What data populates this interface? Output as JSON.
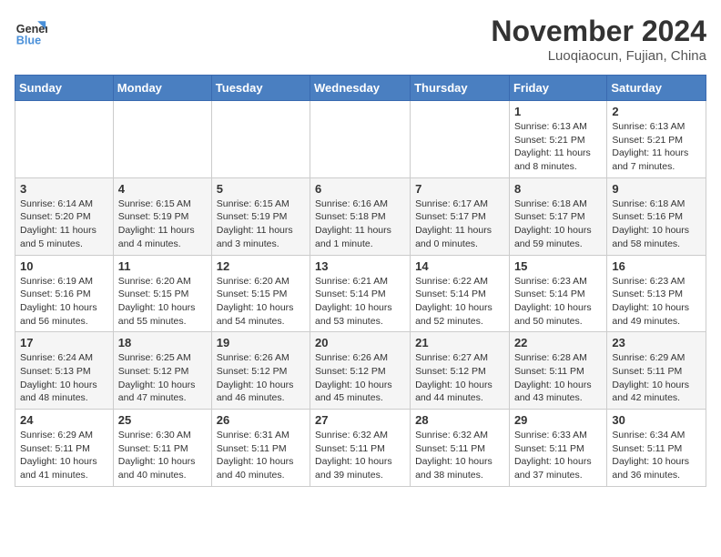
{
  "header": {
    "logo_line1": "General",
    "logo_line2": "Blue",
    "month_title": "November 2024",
    "location": "Luoqiaocun, Fujian, China"
  },
  "weekdays": [
    "Sunday",
    "Monday",
    "Tuesday",
    "Wednesday",
    "Thursday",
    "Friday",
    "Saturday"
  ],
  "weeks": [
    [
      {
        "day": "",
        "info": ""
      },
      {
        "day": "",
        "info": ""
      },
      {
        "day": "",
        "info": ""
      },
      {
        "day": "",
        "info": ""
      },
      {
        "day": "",
        "info": ""
      },
      {
        "day": "1",
        "info": "Sunrise: 6:13 AM\nSunset: 5:21 PM\nDaylight: 11 hours and 8 minutes."
      },
      {
        "day": "2",
        "info": "Sunrise: 6:13 AM\nSunset: 5:21 PM\nDaylight: 11 hours and 7 minutes."
      }
    ],
    [
      {
        "day": "3",
        "info": "Sunrise: 6:14 AM\nSunset: 5:20 PM\nDaylight: 11 hours and 5 minutes."
      },
      {
        "day": "4",
        "info": "Sunrise: 6:15 AM\nSunset: 5:19 PM\nDaylight: 11 hours and 4 minutes."
      },
      {
        "day": "5",
        "info": "Sunrise: 6:15 AM\nSunset: 5:19 PM\nDaylight: 11 hours and 3 minutes."
      },
      {
        "day": "6",
        "info": "Sunrise: 6:16 AM\nSunset: 5:18 PM\nDaylight: 11 hours and 1 minute."
      },
      {
        "day": "7",
        "info": "Sunrise: 6:17 AM\nSunset: 5:17 PM\nDaylight: 11 hours and 0 minutes."
      },
      {
        "day": "8",
        "info": "Sunrise: 6:18 AM\nSunset: 5:17 PM\nDaylight: 10 hours and 59 minutes."
      },
      {
        "day": "9",
        "info": "Sunrise: 6:18 AM\nSunset: 5:16 PM\nDaylight: 10 hours and 58 minutes."
      }
    ],
    [
      {
        "day": "10",
        "info": "Sunrise: 6:19 AM\nSunset: 5:16 PM\nDaylight: 10 hours and 56 minutes."
      },
      {
        "day": "11",
        "info": "Sunrise: 6:20 AM\nSunset: 5:15 PM\nDaylight: 10 hours and 55 minutes."
      },
      {
        "day": "12",
        "info": "Sunrise: 6:20 AM\nSunset: 5:15 PM\nDaylight: 10 hours and 54 minutes."
      },
      {
        "day": "13",
        "info": "Sunrise: 6:21 AM\nSunset: 5:14 PM\nDaylight: 10 hours and 53 minutes."
      },
      {
        "day": "14",
        "info": "Sunrise: 6:22 AM\nSunset: 5:14 PM\nDaylight: 10 hours and 52 minutes."
      },
      {
        "day": "15",
        "info": "Sunrise: 6:23 AM\nSunset: 5:14 PM\nDaylight: 10 hours and 50 minutes."
      },
      {
        "day": "16",
        "info": "Sunrise: 6:23 AM\nSunset: 5:13 PM\nDaylight: 10 hours and 49 minutes."
      }
    ],
    [
      {
        "day": "17",
        "info": "Sunrise: 6:24 AM\nSunset: 5:13 PM\nDaylight: 10 hours and 48 minutes."
      },
      {
        "day": "18",
        "info": "Sunrise: 6:25 AM\nSunset: 5:12 PM\nDaylight: 10 hours and 47 minutes."
      },
      {
        "day": "19",
        "info": "Sunrise: 6:26 AM\nSunset: 5:12 PM\nDaylight: 10 hours and 46 minutes."
      },
      {
        "day": "20",
        "info": "Sunrise: 6:26 AM\nSunset: 5:12 PM\nDaylight: 10 hours and 45 minutes."
      },
      {
        "day": "21",
        "info": "Sunrise: 6:27 AM\nSunset: 5:12 PM\nDaylight: 10 hours and 44 minutes."
      },
      {
        "day": "22",
        "info": "Sunrise: 6:28 AM\nSunset: 5:11 PM\nDaylight: 10 hours and 43 minutes."
      },
      {
        "day": "23",
        "info": "Sunrise: 6:29 AM\nSunset: 5:11 PM\nDaylight: 10 hours and 42 minutes."
      }
    ],
    [
      {
        "day": "24",
        "info": "Sunrise: 6:29 AM\nSunset: 5:11 PM\nDaylight: 10 hours and 41 minutes."
      },
      {
        "day": "25",
        "info": "Sunrise: 6:30 AM\nSunset: 5:11 PM\nDaylight: 10 hours and 40 minutes."
      },
      {
        "day": "26",
        "info": "Sunrise: 6:31 AM\nSunset: 5:11 PM\nDaylight: 10 hours and 40 minutes."
      },
      {
        "day": "27",
        "info": "Sunrise: 6:32 AM\nSunset: 5:11 PM\nDaylight: 10 hours and 39 minutes."
      },
      {
        "day": "28",
        "info": "Sunrise: 6:32 AM\nSunset: 5:11 PM\nDaylight: 10 hours and 38 minutes."
      },
      {
        "day": "29",
        "info": "Sunrise: 6:33 AM\nSunset: 5:11 PM\nDaylight: 10 hours and 37 minutes."
      },
      {
        "day": "30",
        "info": "Sunrise: 6:34 AM\nSunset: 5:11 PM\nDaylight: 10 hours and 36 minutes."
      }
    ]
  ]
}
